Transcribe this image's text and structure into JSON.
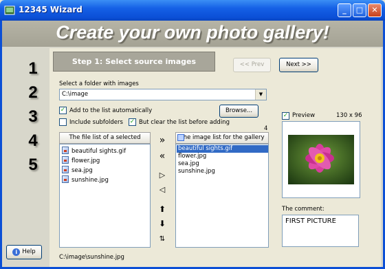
{
  "window": {
    "title": "12345 Wizard",
    "minimize": "_",
    "maximize": "□",
    "close": "✕"
  },
  "banner": {
    "title": "Create your own photo gallery!"
  },
  "steps": [
    "1",
    "2",
    "3",
    "4",
    "5"
  ],
  "step": {
    "title": "Step 1:  Select source images"
  },
  "nav": {
    "prev_label": "<< Prev",
    "next_label": "Next >>"
  },
  "folder": {
    "label": "Select a folder with images",
    "value": "C:\\image"
  },
  "browse_label": "Browse...",
  "options": {
    "add_auto": {
      "label": "Add to the list automatically",
      "checked": true
    },
    "include_subfolders": {
      "label": "Include subfolders",
      "checked": false
    },
    "clear_before": {
      "label": "But clear the list before adding",
      "checked": true
    }
  },
  "file_list": {
    "header": "The file list of a selected folder",
    "items": [
      "beautiful sights.gif",
      "flower.jpg",
      "sea.jpg",
      "sunshine.jpg"
    ]
  },
  "gallery": {
    "header": "The image list for the gallery",
    "count": "4",
    "items": [
      "beautiful sights.gif",
      "flower.jpg",
      "sea.jpg",
      "sunshine.jpg"
    ],
    "selected_index": 0
  },
  "preview": {
    "label": "Preview",
    "checked": true,
    "size": "130 x 96"
  },
  "comment": {
    "label": "The comment:",
    "value": "FIRST PICTURE"
  },
  "status": {
    "path": "C:\\image\\sunshine.jpg"
  },
  "help_label": "Help",
  "colors": {
    "titlebar": "#0b4fd6",
    "selection": "#316ac5",
    "banner": "#a8a69a"
  }
}
